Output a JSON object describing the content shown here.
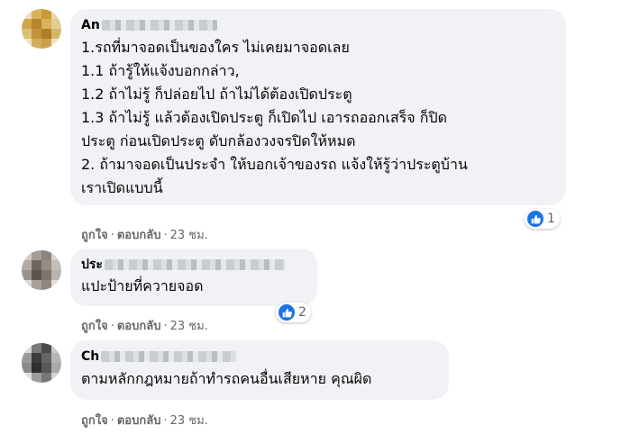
{
  "colors": {
    "bubble_bg": "#f0f2f5",
    "like_blue": "#1b74e4",
    "meta_gray": "#65676b"
  },
  "comments": [
    {
      "author": "An",
      "lines": [
        "1.รถที่มาจอดเป็นของใคร ไม่เคยมาจอดเลย",
        "1.1  ถ้ารู้ให้แจ้งบอกกล่าว,",
        "1.2  ถ้าไม่รู้ ก็ปล่อยไป ถ้าไม่ได้ต้องเปิดประตู",
        "1.3  ถ้าไม่รู้ แล้วต้องเปิดประตู ก็เปิดไป เอารถออกเสร็จ ก็ปิด",
        "ประตู ก่อนเปิดประตู ดับกล้องวงจรปิดให้หมด",
        "2.  ถ้ามาจอดเป็นประจำ ให้บอกเจ้าของรถ แจ้งให้รู้ว่าประตูบ้าน",
        "เราเปิดแบบนี้"
      ],
      "like_label": "ถูกใจ",
      "reply_label": "ตอบกลับ",
      "time": "23 ชม.",
      "reaction_count": "1",
      "reaction_icon": "like-icon"
    },
    {
      "author": "ประ",
      "lines": [
        "แปะป้ายที่ควายจอด"
      ],
      "like_label": "ถูกใจ",
      "reply_label": "ตอบกลับ",
      "time": "23 ชม.",
      "reaction_count": "2",
      "reaction_icon": "like-icon"
    },
    {
      "author": "Ch",
      "lines": [
        "ตามหลักกฎหมายถ้าทำรถคนอื่นเสียหาย คุณผิด"
      ],
      "like_label": "ถูกใจ",
      "reply_label": "ตอบกลับ",
      "time": "23 ชม."
    }
  ]
}
